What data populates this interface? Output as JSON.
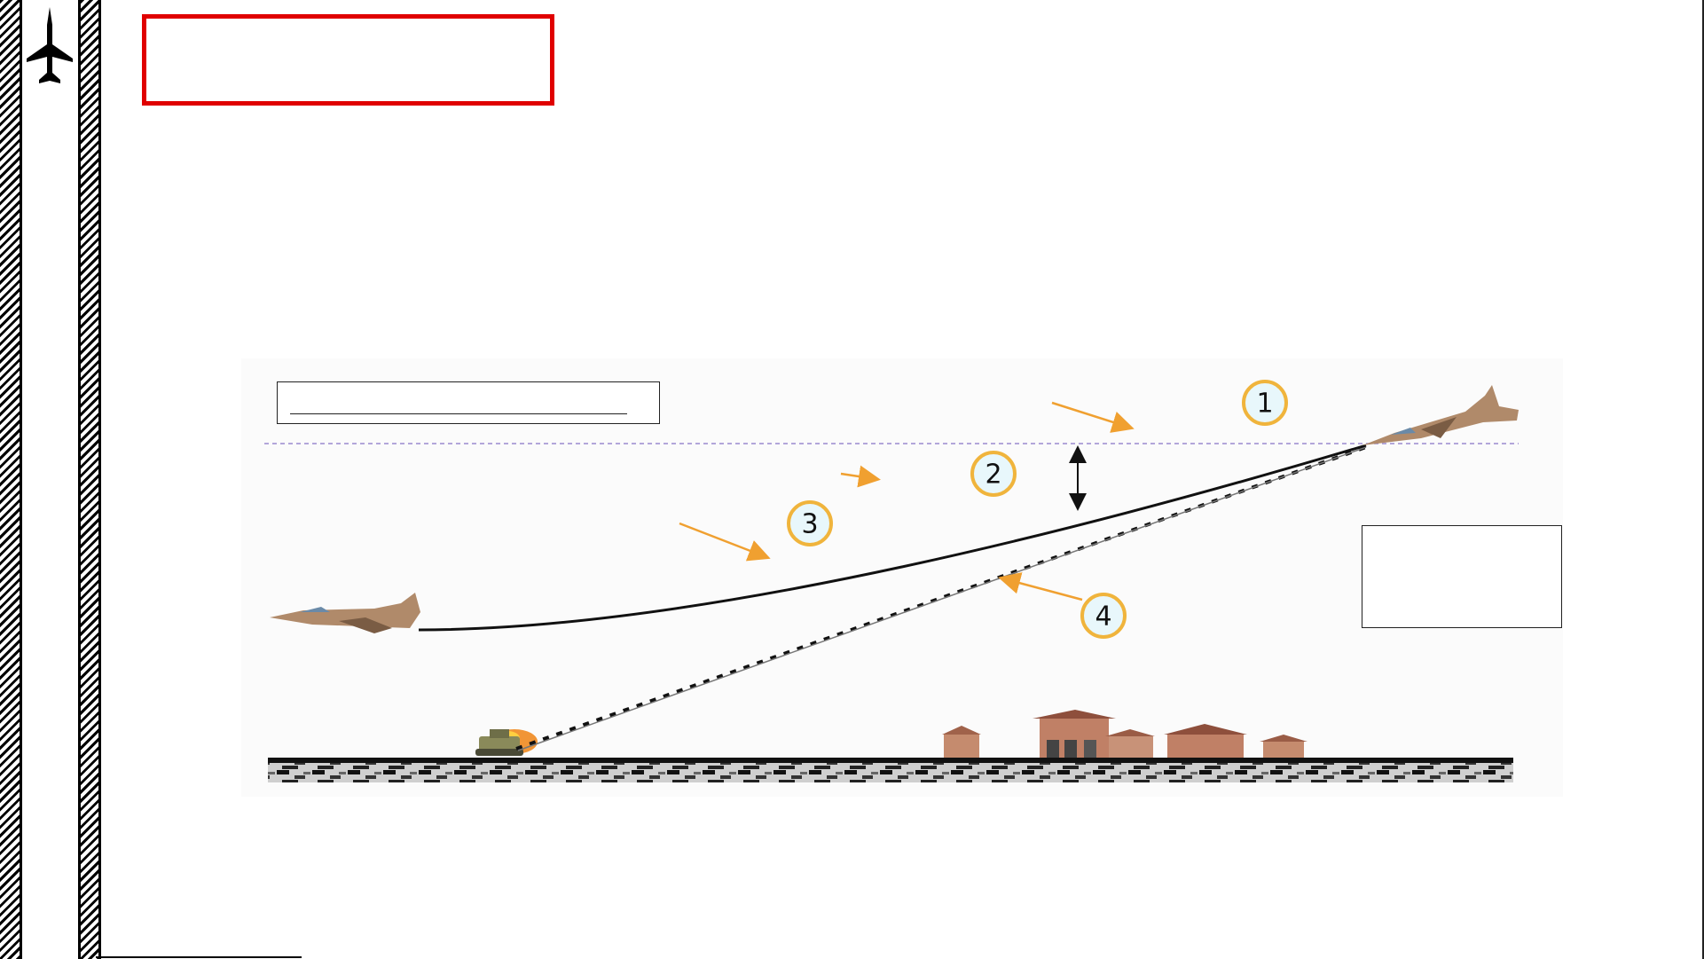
{
  "header": {
    "icon": "fighter-jet-icon",
    "accent_color": "#e00000"
  },
  "diagram": {
    "callouts": [
      {
        "label": "1"
      },
      {
        "label": "2"
      },
      {
        "label": "3"
      },
      {
        "label": "4"
      }
    ],
    "colors": {
      "callout_fill": "#e8f7fb",
      "callout_ring": "#f0b43c",
      "arrow": "#f0a030",
      "horizon": "#9a8ad0"
    }
  }
}
